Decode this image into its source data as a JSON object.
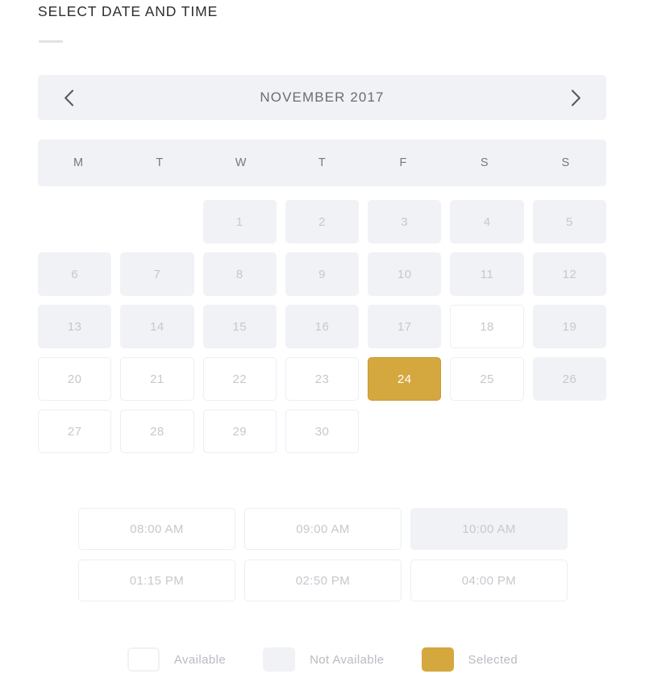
{
  "header": {
    "title": "SELECT DATE AND TIME"
  },
  "calendar": {
    "month_label": "NOVEMBER 2017",
    "prev_icon": "chevron-left-icon",
    "next_icon": "chevron-right-icon",
    "weekdays": [
      "M",
      "T",
      "W",
      "T",
      "F",
      "S",
      "S"
    ],
    "leading_blanks": 2,
    "days": [
      {
        "label": "1",
        "state": "unavailable"
      },
      {
        "label": "2",
        "state": "unavailable"
      },
      {
        "label": "3",
        "state": "unavailable"
      },
      {
        "label": "4",
        "state": "unavailable"
      },
      {
        "label": "5",
        "state": "unavailable"
      },
      {
        "label": "6",
        "state": "unavailable"
      },
      {
        "label": "7",
        "state": "unavailable"
      },
      {
        "label": "8",
        "state": "unavailable"
      },
      {
        "label": "9",
        "state": "unavailable"
      },
      {
        "label": "10",
        "state": "unavailable"
      },
      {
        "label": "11",
        "state": "unavailable"
      },
      {
        "label": "12",
        "state": "unavailable"
      },
      {
        "label": "13",
        "state": "unavailable"
      },
      {
        "label": "14",
        "state": "unavailable"
      },
      {
        "label": "15",
        "state": "unavailable"
      },
      {
        "label": "16",
        "state": "unavailable"
      },
      {
        "label": "17",
        "state": "unavailable"
      },
      {
        "label": "18",
        "state": "available"
      },
      {
        "label": "19",
        "state": "unavailable"
      },
      {
        "label": "20",
        "state": "available"
      },
      {
        "label": "21",
        "state": "available"
      },
      {
        "label": "22",
        "state": "available"
      },
      {
        "label": "23",
        "state": "available"
      },
      {
        "label": "24",
        "state": "selected"
      },
      {
        "label": "25",
        "state": "available"
      },
      {
        "label": "26",
        "state": "unavailable"
      },
      {
        "label": "27",
        "state": "available"
      },
      {
        "label": "28",
        "state": "available"
      },
      {
        "label": "29",
        "state": "available"
      },
      {
        "label": "30",
        "state": "available"
      }
    ]
  },
  "time_slots": [
    {
      "label": "08:00 AM",
      "state": "available"
    },
    {
      "label": "09:00 AM",
      "state": "available"
    },
    {
      "label": "10:00 AM",
      "state": "unavailable"
    },
    {
      "label": "01:15 PM",
      "state": "available"
    },
    {
      "label": "02:50 PM",
      "state": "available"
    },
    {
      "label": "04:00 PM",
      "state": "available"
    }
  ],
  "legend": [
    {
      "label": "Available",
      "state": "available"
    },
    {
      "label": "Not Available",
      "state": "unavailable"
    },
    {
      "label": "Selected",
      "state": "selected"
    }
  ],
  "colors": {
    "selected": "#d5a83f",
    "unavailable_fill": "#f1f2f6",
    "available_border": "#eceef3",
    "muted_text": "#c6c8ce",
    "title_text": "#2e2e2e"
  }
}
